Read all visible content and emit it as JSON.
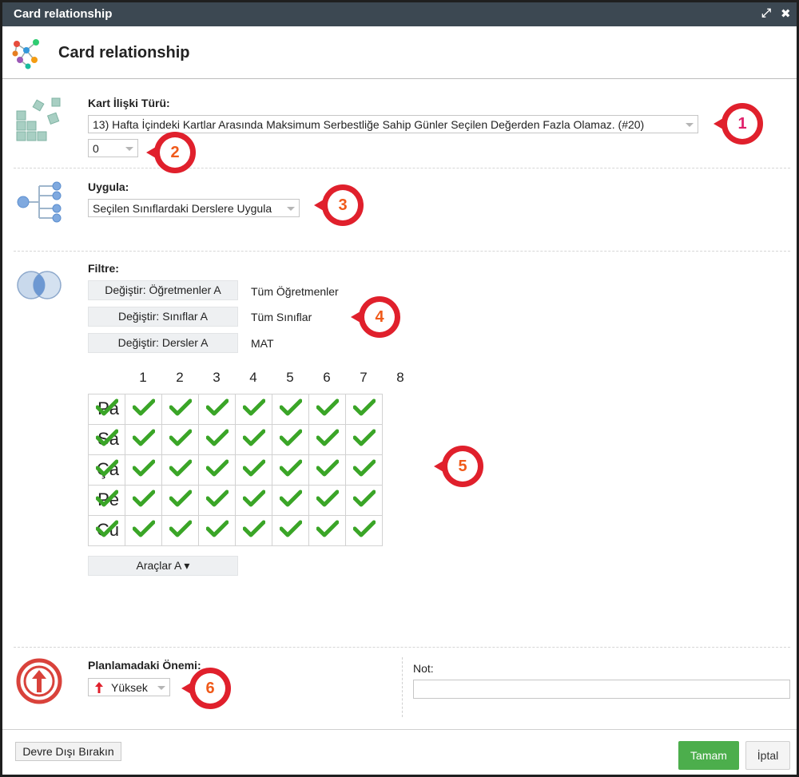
{
  "window": {
    "title": "Card relationship",
    "maximize_glyph": "⤢",
    "close_glyph": "✖"
  },
  "header": {
    "title": "Card relationship",
    "icon": "network-icon"
  },
  "relation_type": {
    "label": "Kart İlişki Türü:",
    "selected": "13) Hafta İçindeki Kartlar Arasında Maksimum Serbestliğe Sahip Günler Seçilen Değerden Fazla Olamaz. (#20)",
    "value": "0"
  },
  "apply": {
    "label": "Uygula:",
    "selected": "Seçilen Sınıflardaki Derslere Uygula"
  },
  "filter": {
    "label": "Filtre:",
    "rows": [
      {
        "button": "Değiştir: Öğretmenler A",
        "value": "Tüm Öğretmenler"
      },
      {
        "button": "Değiştir: Sınıflar A",
        "value": "Tüm Sınıflar"
      },
      {
        "button": "Değiştir: Dersler A",
        "value": "MAT"
      }
    ]
  },
  "grid": {
    "columns": [
      "1",
      "2",
      "3",
      "4",
      "5",
      "6",
      "7",
      "8"
    ],
    "rows": [
      "Pa",
      "Sa",
      "Ça",
      "Pe",
      "Cu"
    ],
    "all_checked": true,
    "check_color": "#3aa527"
  },
  "tools_button": "Araçlar A ▾",
  "importance": {
    "label": "Planlamadaki Önemi:",
    "selected": "Yüksek",
    "icon": "arrow-up-icon",
    "color": "#e0202c"
  },
  "note": {
    "label": "Not:",
    "value": ""
  },
  "callouts": [
    "1",
    "2",
    "3",
    "4",
    "5",
    "6"
  ],
  "footer": {
    "disable_button": "Devre Dışı Bırakın",
    "ok_button": "Tamam",
    "cancel_button": "İptal"
  }
}
